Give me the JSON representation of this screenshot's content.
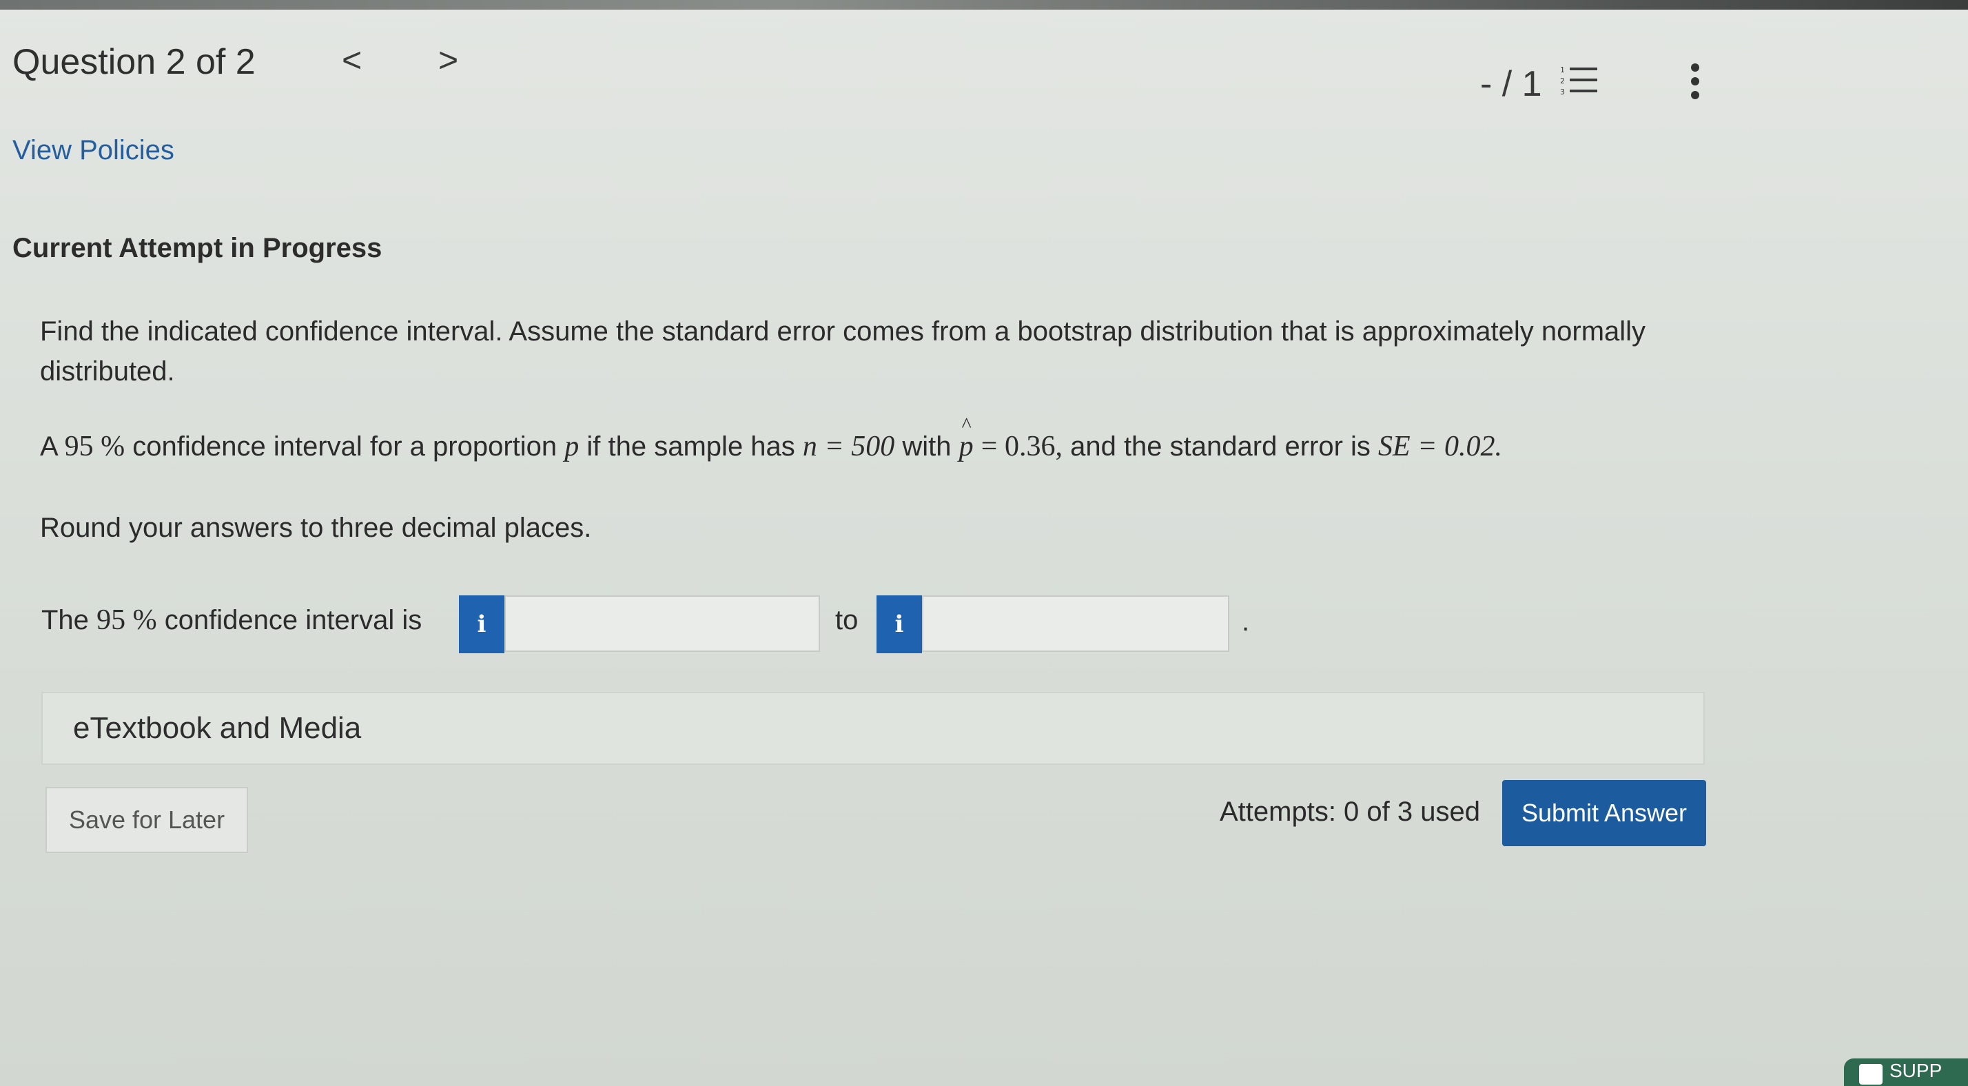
{
  "header": {
    "question_title": "Question 2 of 2",
    "prev_glyph": "<",
    "next_glyph": ">",
    "score": "- / 1"
  },
  "links": {
    "view_policies": "View Policies"
  },
  "attempt_heading": "Current Attempt in Progress",
  "question": {
    "intro": "Find the indicated confidence interval. Assume the standard error comes from a bootstrap distribution that is approximately normally distributed.",
    "line2": {
      "prefix": "A",
      "pct": "95 %",
      "text_a": "confidence interval for a proportion",
      "p": "p",
      "text_b": "if the sample has",
      "n_expr": "n = 500",
      "with": "with",
      "phat": "p",
      "phat_value": "= 0.36,",
      "text_c": "and the standard error is",
      "se_expr": "SE = 0.02."
    },
    "round_instruction": "Round your answers to three decimal places."
  },
  "interval_row": {
    "label_prefix": "The",
    "pct": "95 %",
    "label_suffix": "confidence interval is",
    "info_glyph": "i",
    "lower_value": "",
    "upper_value": "",
    "to_label": "to",
    "period": "."
  },
  "etextbook_label": "eTextbook and Media",
  "footer": {
    "save_label": "Save for Later",
    "attempts_text": "Attempts: 0 of 3 used",
    "submit_label": "Submit Answer"
  },
  "support_tab_label": "SUPP",
  "icons": {
    "question_list": "numbered-list-icon",
    "more": "vertical-ellipsis-icon",
    "info": "info-icon"
  },
  "colors": {
    "accent_blue": "#1b5b9e",
    "info_blue": "#1f63b0",
    "link_blue": "#245e9d"
  }
}
